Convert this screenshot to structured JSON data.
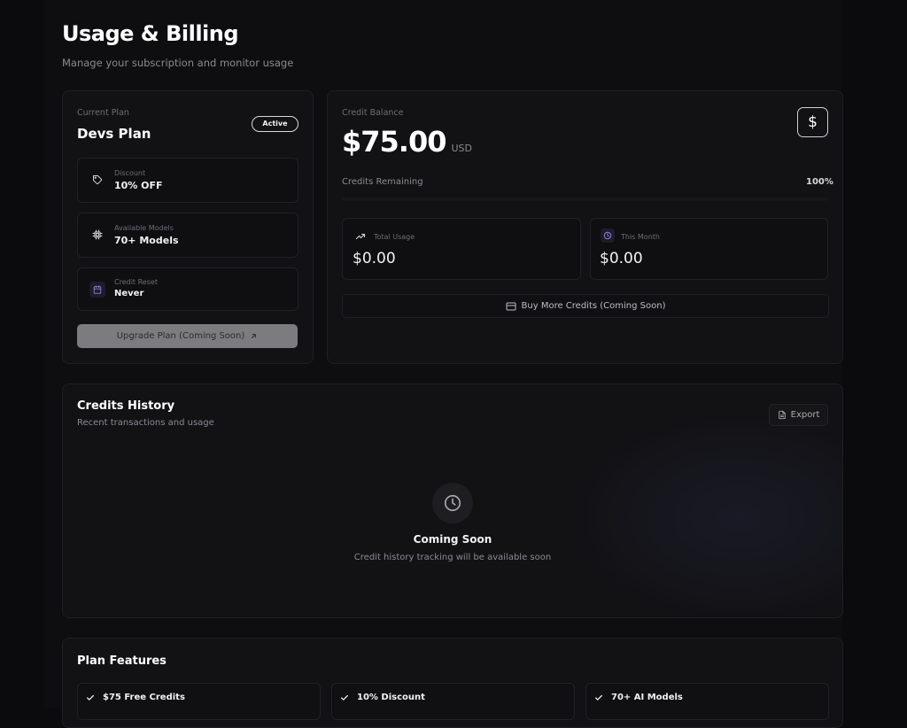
{
  "header": {
    "title": "Usage & Billing",
    "subtitle": "Manage your subscription and monitor usage"
  },
  "plan": {
    "section_label": "Current Plan",
    "name": "Devs Plan",
    "status": "Active",
    "details": [
      {
        "label": "Discount",
        "value": "10% OFF",
        "icon": "tag-icon"
      },
      {
        "label": "Available Models",
        "value": "70+ Models",
        "icon": "chip-icon"
      },
      {
        "label": "Credit Reset",
        "value": "Never",
        "icon": "calendar-icon"
      }
    ],
    "upgrade_label": "Upgrade Plan (Coming Soon)"
  },
  "credit": {
    "section_label": "Credit Balance",
    "amount": "$75.00",
    "currency": "USD",
    "icon_glyph": "$",
    "remaining_label": "Credits Remaining",
    "remaining_percent": "100%",
    "total_usage_label": "Total Usage",
    "total_usage_value": "$0.00",
    "this_month_label": "This Month",
    "this_month_value": "$0.00",
    "buy_label": "Buy More Credits (Coming Soon)"
  },
  "history": {
    "title": "Credits History",
    "subtitle": "Recent transactions and usage",
    "export_label": "Export",
    "empty_title": "Coming Soon",
    "empty_text": "Credit history tracking will be available soon"
  },
  "features": {
    "title": "Plan Features",
    "items": [
      "$75 Free Credits",
      "10% Discount",
      "70+ AI Models"
    ]
  },
  "colors": {
    "background": "#0b0b0d",
    "card": "#121215",
    "accent_purple": "#8a83d6"
  }
}
